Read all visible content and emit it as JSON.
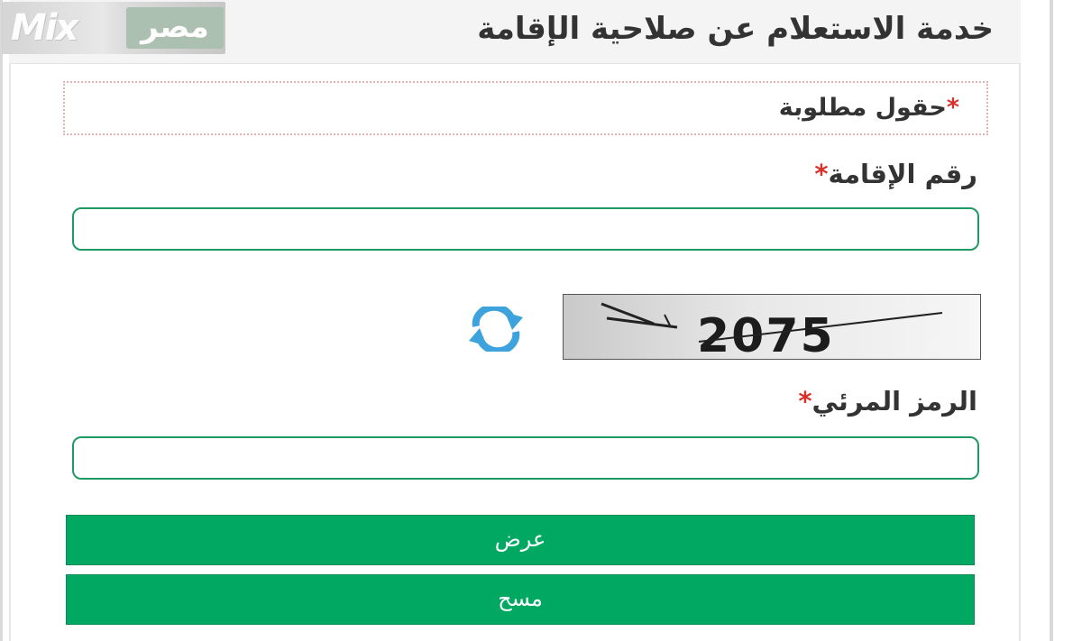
{
  "header": {
    "title": "خدمة الاستعلام عن صلاحية الإقامة"
  },
  "watermark": {
    "latin": "Mix",
    "arabic": "مصر"
  },
  "required_note": {
    "star": "*",
    "text": "حقول مطلوبة"
  },
  "form": {
    "iqama_label": "رقم الإقامة",
    "iqama_star": "*",
    "iqama_value": "",
    "captcha_image_text": "2075",
    "captcha_label": "الرمز المرئي",
    "captcha_star": "*",
    "captcha_value": ""
  },
  "icons": {
    "refresh": "refresh-icon"
  },
  "colors": {
    "button_green": "#00a862",
    "input_border": "#1f9a63",
    "required_star": "#d6312b",
    "refresh_blue": "#3ea3dc"
  },
  "buttons": {
    "show_label": "عرض",
    "clear_label": "مسح"
  }
}
